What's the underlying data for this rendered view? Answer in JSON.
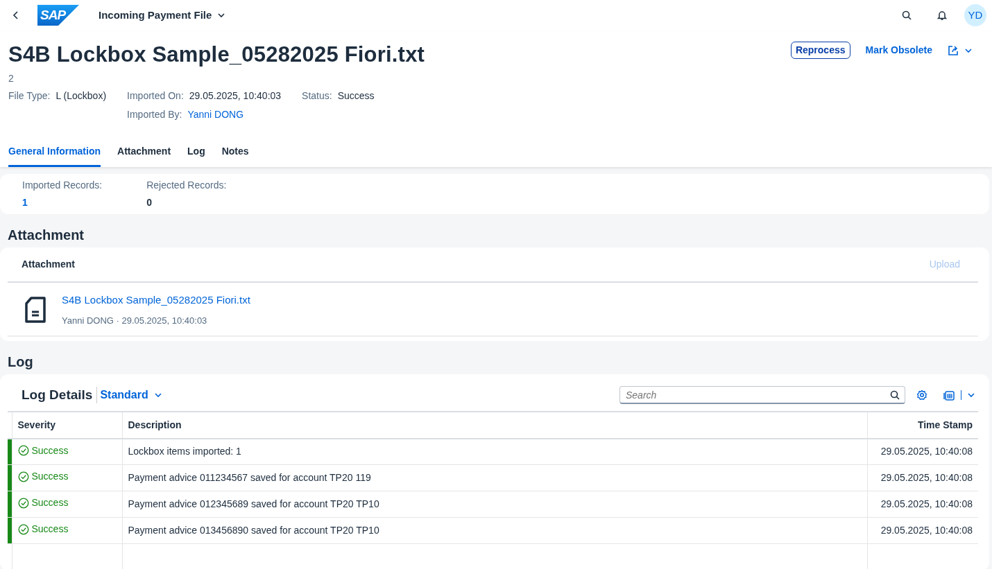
{
  "shell": {
    "logo_text": "SAP",
    "app_title": "Incoming Payment File",
    "avatar_initials": "YD"
  },
  "header": {
    "title": "S4B Lockbox Sample_05282025 Fiori.txt",
    "subtitle": "2",
    "actions": [
      {
        "label": "Reprocess",
        "kind": "emphasized"
      },
      {
        "label": "Mark Obsolete",
        "kind": "transparent"
      }
    ],
    "attributes": [
      {
        "label": "File Type:",
        "value": "L (Lockbox)",
        "kind": "text"
      },
      {
        "label": "Imported On:",
        "value": "29.05.2025, 10:40:03",
        "kind": "text"
      },
      {
        "label": "Status:",
        "value": "Success",
        "kind": "text"
      },
      {
        "label": "Imported By:",
        "value": "Yanni DONG",
        "kind": "link"
      }
    ]
  },
  "tabs": [
    {
      "label": "General Information",
      "selected": true
    },
    {
      "label": "Attachment",
      "selected": false
    },
    {
      "label": "Log",
      "selected": false
    },
    {
      "label": "Notes",
      "selected": false
    }
  ],
  "general": [
    {
      "label": "Imported Records:",
      "value": "1",
      "kind": "link"
    },
    {
      "label": "Rejected Records:",
      "value": "0",
      "kind": "text"
    }
  ],
  "attachment_section": {
    "heading": "Attachment",
    "card_title": "Attachment",
    "upload_label": "Upload",
    "upload_disabled": true,
    "files": [
      {
        "name": "S4B Lockbox Sample_05282025 Fiori.txt",
        "meta": "Yanni DONG · 29.05.2025, 10:40:03"
      }
    ]
  },
  "log_section": {
    "heading": "Log",
    "table_title": "Log Details",
    "variant": "Standard",
    "search": {
      "placeholder": "Search"
    },
    "columns": [
      "Severity",
      "Description",
      "Time Stamp"
    ],
    "rows": [
      {
        "severity": "Success",
        "kind": "success",
        "description": "Lockbox items imported: 1",
        "time_stamp": "29.05.2025, 10:40:08"
      },
      {
        "severity": "Success",
        "kind": "success",
        "description": "Payment advice 011234567 saved for account TP20 119",
        "time_stamp": "29.05.2025, 10:40:08"
      },
      {
        "severity": "Success",
        "kind": "success",
        "description": "Payment advice 012345689 saved for account TP20 TP10",
        "time_stamp": "29.05.2025, 10:40:08"
      },
      {
        "severity": "Success",
        "kind": "success",
        "description": "Payment advice 013456890 saved for account TP20 TP10",
        "time_stamp": "29.05.2025, 10:40:08"
      }
    ]
  }
}
